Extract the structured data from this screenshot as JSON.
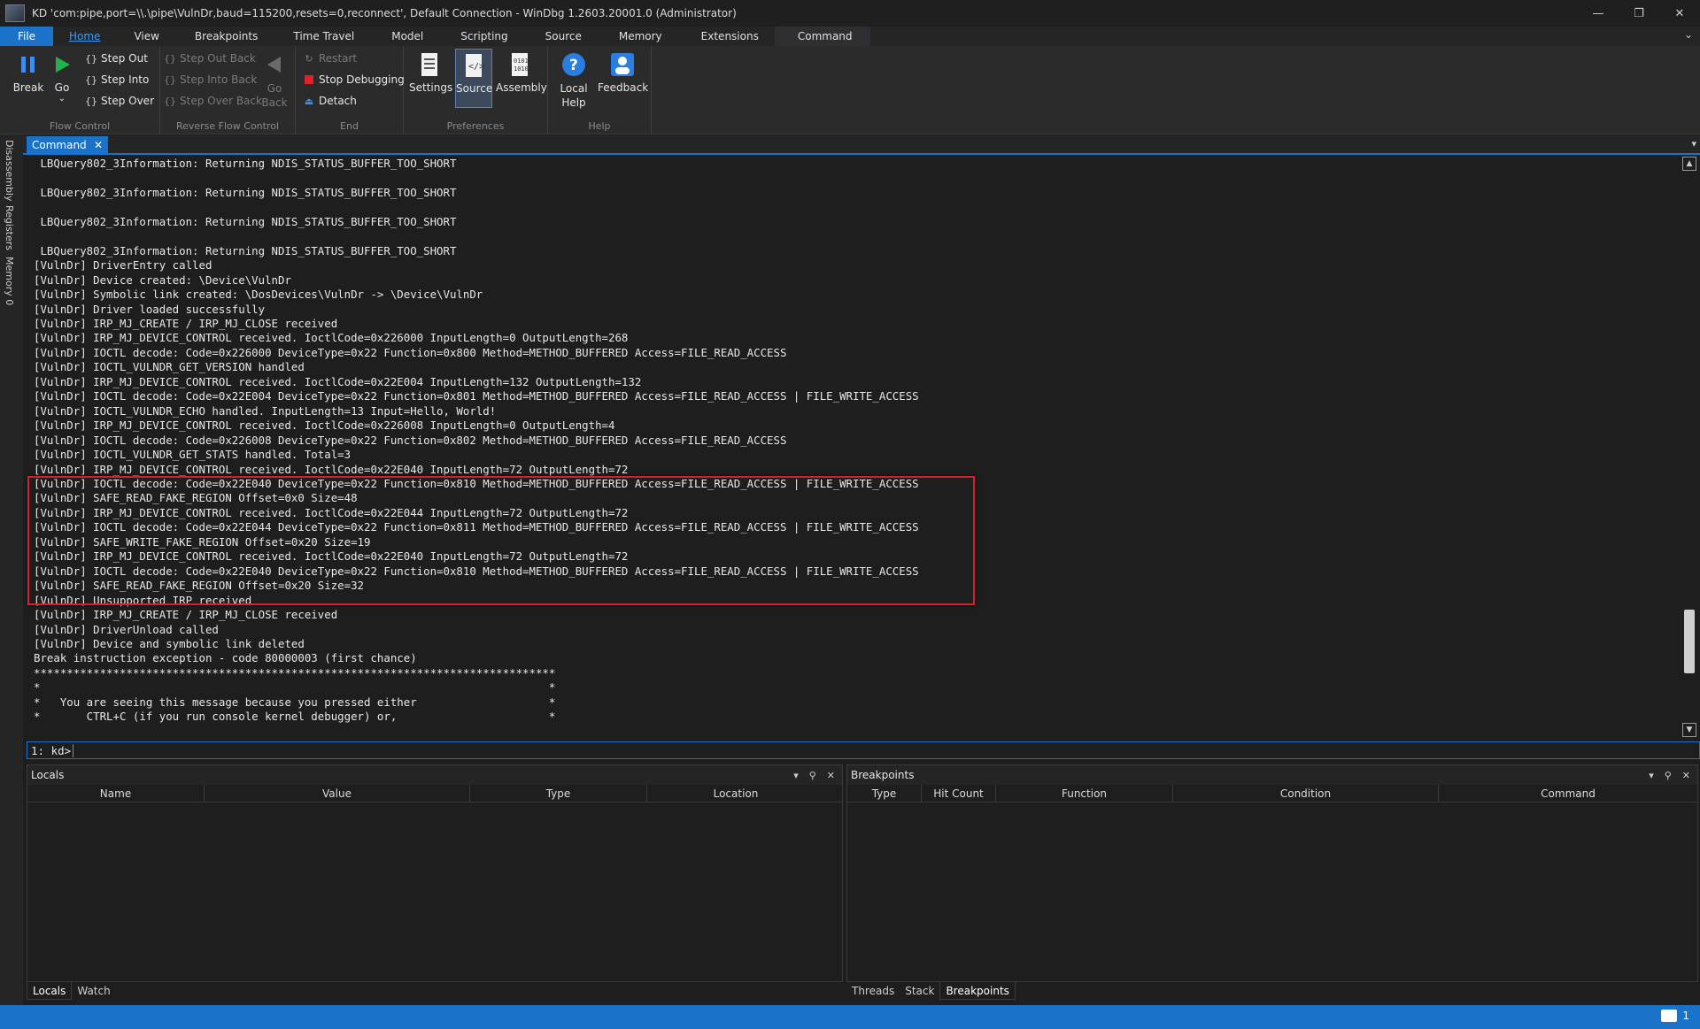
{
  "window": {
    "title": "KD 'com:pipe,port=\\\\.\\pipe\\VulnDr,baud=115200,resets=0,reconnect', Default Connection  - WinDbg 1.2603.20001.0 (Administrator)",
    "minimize": "—",
    "maximize": "❐",
    "close": "✕"
  },
  "menu": {
    "items": [
      "File",
      "Home",
      "View",
      "Breakpoints",
      "Time Travel",
      "Model",
      "Scripting",
      "Source",
      "Memory",
      "Extensions",
      "Command"
    ],
    "collapse": "⌄"
  },
  "ribbon": {
    "flow_control": {
      "label": "Flow Control",
      "break": "Break",
      "go": "Go",
      "step_out": "Step Out",
      "step_into": "Step Into",
      "step_over": "Step Over"
    },
    "reverse_flow": {
      "label": "Reverse Flow Control",
      "step_out_back": "Step Out Back",
      "step_into_back": "Step Into Back",
      "step_over_back": "Step Over Back",
      "go_back": "Go Back"
    },
    "end": {
      "label": "End",
      "restart": "Restart",
      "stop": "Stop Debugging",
      "detach": "Detach"
    },
    "preferences": {
      "label": "Preferences",
      "settings": "Settings",
      "source": "Source",
      "assembly": "Assembly"
    },
    "help": {
      "label": "Help",
      "local_help": "Local Help",
      "feedback": "Feedback"
    }
  },
  "left_tabs": [
    "Disassembly",
    "Registers",
    "Memory 0"
  ],
  "command_window": {
    "tab_label": "Command",
    "lines": [
      " LBQuery802_3Information: Returning NDIS_STATUS_BUFFER_TOO_SHORT",
      "",
      " LBQuery802_3Information: Returning NDIS_STATUS_BUFFER_TOO_SHORT",
      "",
      " LBQuery802_3Information: Returning NDIS_STATUS_BUFFER_TOO_SHORT",
      "",
      " LBQuery802_3Information: Returning NDIS_STATUS_BUFFER_TOO_SHORT",
      "[VulnDr] DriverEntry called",
      "[VulnDr] Device created: \\Device\\VulnDr",
      "[VulnDr] Symbolic link created: \\DosDevices\\VulnDr -> \\Device\\VulnDr",
      "[VulnDr] Driver loaded successfully",
      "[VulnDr] IRP_MJ_CREATE / IRP_MJ_CLOSE received",
      "[VulnDr] IRP_MJ_DEVICE_CONTROL received. IoctlCode=0x226000 InputLength=0 OutputLength=268",
      "[VulnDr] IOCTL decode: Code=0x226000 DeviceType=0x22 Function=0x800 Method=METHOD_BUFFERED Access=FILE_READ_ACCESS",
      "[VulnDr] IOCTL_VULNDR_GET_VERSION handled",
      "[VulnDr] IRP_MJ_DEVICE_CONTROL received. IoctlCode=0x22E004 InputLength=132 OutputLength=132",
      "[VulnDr] IOCTL decode: Code=0x22E004 DeviceType=0x22 Function=0x801 Method=METHOD_BUFFERED Access=FILE_READ_ACCESS | FILE_WRITE_ACCESS",
      "[VulnDr] IOCTL_VULNDR_ECHO handled. InputLength=13 Input=Hello, World!",
      "[VulnDr] IRP_MJ_DEVICE_CONTROL received. IoctlCode=0x226008 InputLength=0 OutputLength=4",
      "[VulnDr] IOCTL decode: Code=0x226008 DeviceType=0x22 Function=0x802 Method=METHOD_BUFFERED Access=FILE_READ_ACCESS",
      "[VulnDr] IOCTL_VULNDR_GET_STATS handled. Total=3",
      "[VulnDr] IRP_MJ_DEVICE_CONTROL received. IoctlCode=0x22E040 InputLength=72 OutputLength=72",
      "[VulnDr] IOCTL decode: Code=0x22E040 DeviceType=0x22 Function=0x810 Method=METHOD_BUFFERED Access=FILE_READ_ACCESS | FILE_WRITE_ACCESS",
      "[VulnDr] SAFE_READ_FAKE_REGION Offset=0x0 Size=48",
      "[VulnDr] IRP_MJ_DEVICE_CONTROL received. IoctlCode=0x22E044 InputLength=72 OutputLength=72",
      "[VulnDr] IOCTL decode: Code=0x22E044 DeviceType=0x22 Function=0x811 Method=METHOD_BUFFERED Access=FILE_READ_ACCESS | FILE_WRITE_ACCESS",
      "[VulnDr] SAFE_WRITE_FAKE_REGION Offset=0x20 Size=19",
      "[VulnDr] IRP_MJ_DEVICE_CONTROL received. IoctlCode=0x22E040 InputLength=72 OutputLength=72",
      "[VulnDr] IOCTL decode: Code=0x22E040 DeviceType=0x22 Function=0x810 Method=METHOD_BUFFERED Access=FILE_READ_ACCESS | FILE_WRITE_ACCESS",
      "[VulnDr] SAFE_READ_FAKE_REGION Offset=0x20 Size=32",
      "[VulnDr] Unsupported IRP received",
      "[VulnDr] IRP_MJ_CREATE / IRP_MJ_CLOSE received",
      "[VulnDr] DriverUnload called",
      "[VulnDr] Device and symbolic link deleted",
      "Break instruction exception - code 80000003 (first chance)",
      "*******************************************************************************",
      "*                                                                             *",
      "*   You are seeing this message because you pressed either                    *",
      "*       CTRL+C (if you run console kernel debugger) or,                       *"
    ],
    "prompt": "1: kd>",
    "input_value": ""
  },
  "locals_panel": {
    "title": "Locals",
    "columns": [
      "Name",
      "Value",
      "Type",
      "Location"
    ],
    "tabs": [
      "Locals",
      "Watch"
    ]
  },
  "breakpoints_panel": {
    "title": "Breakpoints",
    "columns": [
      "Type",
      "Hit Count",
      "Function",
      "Condition",
      "Command"
    ],
    "tabs": [
      "Threads",
      "Stack",
      "Breakpoints"
    ]
  },
  "status_bar": {
    "notification_count": "1"
  },
  "colors": {
    "accent": "#1a73c9",
    "highlight_border": "#d8202a",
    "background": "#1e1e1e"
  }
}
